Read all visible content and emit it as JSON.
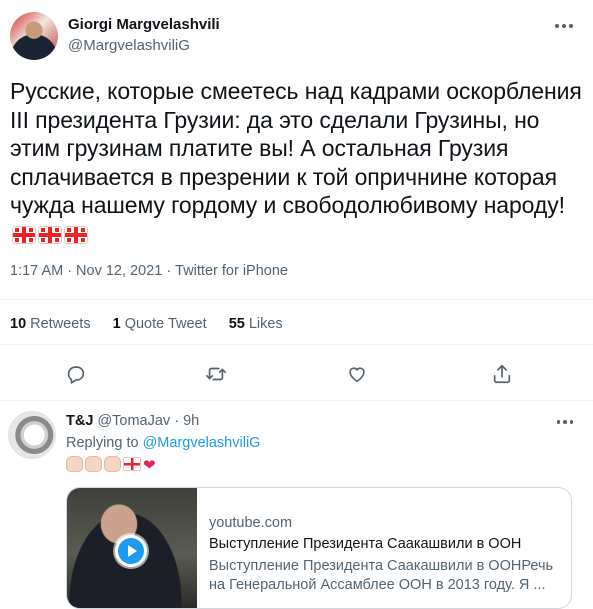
{
  "tweet": {
    "author_name": "Giorgi Margvelashvili",
    "author_handle": "@MargvelashviliG",
    "text": "Русские, которые смеетесь над кадрами оскорбления III президента Грузии: да это сделали Грузины, но этим грузинам платите вы! А остальная Грузия сплачивается в презрении к той опричнине которая чужда нашему гордому и свободолюбивому народу!",
    "time": "1:17 AM",
    "date": "Nov 12, 2021",
    "source": "Twitter for iPhone",
    "separator": "·",
    "emojis": [
      "georgia-flag",
      "georgia-flag",
      "georgia-flag"
    ]
  },
  "stats": {
    "retweets_count": "10",
    "retweets_label": "Retweets",
    "quote_count": "1",
    "quote_label": "Quote Tweet",
    "likes_count": "55",
    "likes_label": "Likes"
  },
  "actions": [
    {
      "name": "reply-icon"
    },
    {
      "name": "retweet-icon"
    },
    {
      "name": "like-icon"
    },
    {
      "name": "share-icon"
    }
  ],
  "reply": {
    "author_name": "T&J",
    "author_handle": "@TomaJav",
    "separator": "·",
    "time_ago": "9h",
    "replying_prefix": "Replying to",
    "replying_mention": "@MargvelashviliG",
    "emojis": [
      "clapping-hands",
      "clapping-hands",
      "clapping-hands",
      "georgia-flag",
      "red-heart"
    ],
    "heart": "❤"
  },
  "link_card": {
    "domain": "youtube.com",
    "title": "Выступление Президента Саакашвили в ООН",
    "description": "Выступление Президента Саакашвили в ООНРечь на Генеральной Ассамблее ООН в 2013 году. Я ..."
  },
  "colors": {
    "accent": "#1d9bf0",
    "secondary_text": "#536471",
    "heart": "#e0245e",
    "border": "#cfd9de"
  }
}
